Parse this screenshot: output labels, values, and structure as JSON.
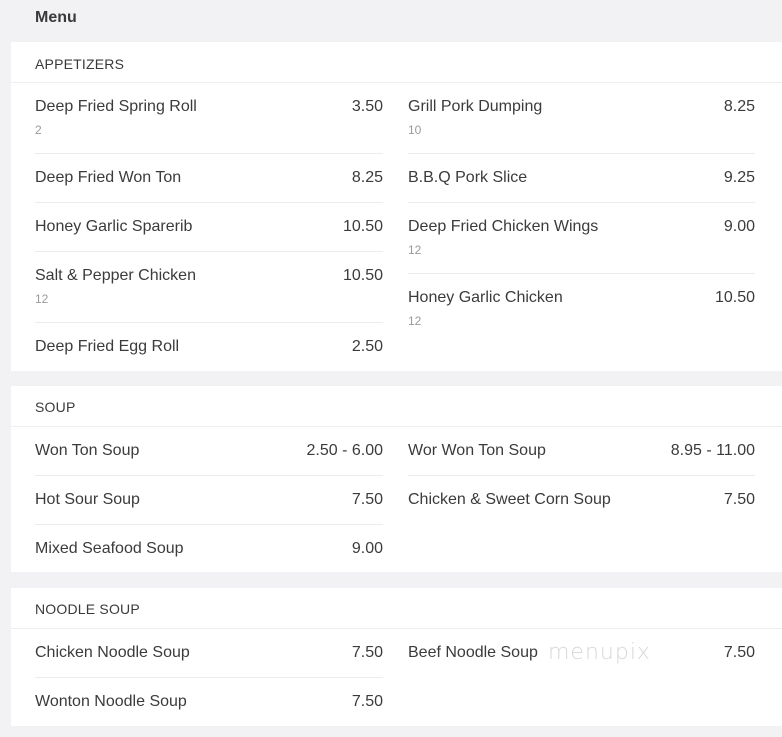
{
  "header": {
    "title": "Menu"
  },
  "watermark": "menupix",
  "sections": [
    {
      "heading": "APPETIZERS",
      "left": [
        {
          "name": "Deep Fried Spring Roll",
          "price": "3.50",
          "sub": "2"
        },
        {
          "name": "Deep Fried Won Ton",
          "price": "8.25"
        },
        {
          "name": "Honey Garlic Sparerib",
          "price": "10.50"
        },
        {
          "name": "Salt & Pepper Chicken",
          "price": "10.50",
          "sub": "12"
        },
        {
          "name": "Deep Fried Egg Roll",
          "price": "2.50"
        }
      ],
      "right": [
        {
          "name": "Grill Pork Dumping",
          "price": "8.25",
          "sub": "10"
        },
        {
          "name": "B.B.Q Pork Slice",
          "price": "9.25"
        },
        {
          "name": "Deep Fried Chicken Wings",
          "price": "9.00",
          "sub": "12"
        },
        {
          "name": "Honey Garlic Chicken",
          "price": "10.50",
          "sub": "12"
        }
      ]
    },
    {
      "heading": "SOUP",
      "left": [
        {
          "name": "Won Ton Soup",
          "price": "2.50 - 6.00"
        },
        {
          "name": "Hot Sour Soup",
          "price": "7.50"
        },
        {
          "name": "Mixed Seafood Soup",
          "price": "9.00"
        }
      ],
      "right": [
        {
          "name": "Wor Won Ton Soup",
          "price": "8.95 - 11.00"
        },
        {
          "name": "Chicken & Sweet Corn Soup",
          "price": "7.50"
        }
      ]
    },
    {
      "heading": "NOODLE SOUP",
      "left": [
        {
          "name": "Chicken Noodle Soup",
          "price": "7.50"
        },
        {
          "name": "Wonton Noodle Soup",
          "price": "7.50"
        }
      ],
      "right": [
        {
          "name": "Beef Noodle Soup",
          "price": "7.50"
        }
      ]
    }
  ]
}
